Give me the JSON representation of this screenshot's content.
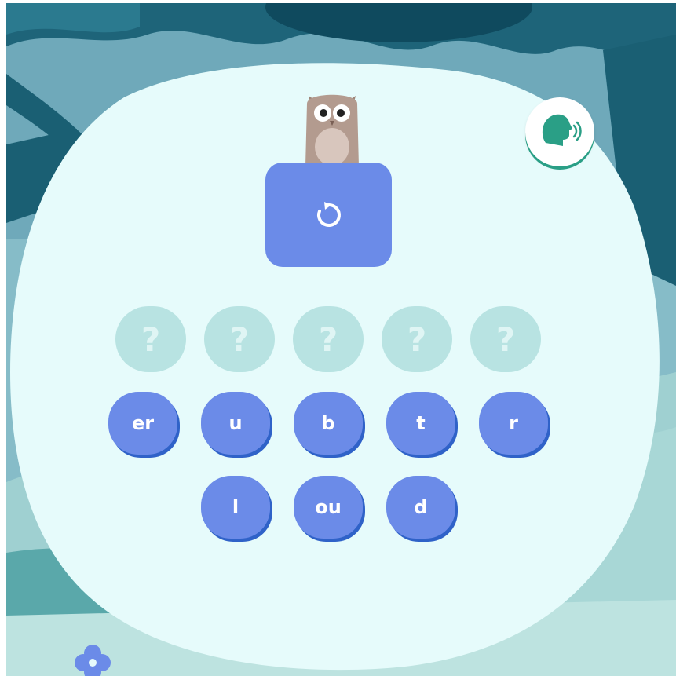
{
  "puzzle": {
    "answer_slots": [
      "?",
      "?",
      "?",
      "?",
      "?"
    ],
    "letter_tiles_row1": [
      "er",
      "u",
      "b",
      "t",
      "r"
    ],
    "letter_tiles_row2": [
      "l",
      "ou",
      "d"
    ]
  },
  "icons": {
    "replay": "replay-icon",
    "speak": "speaking-head-icon",
    "mascot": "owl-mascot"
  },
  "colors": {
    "tile": "#6b8be8",
    "tile_shadow": "#2f62c8",
    "slot": "#b8e3e2",
    "card": "#e6fbfb",
    "speak_accent": "#2a9f86"
  }
}
